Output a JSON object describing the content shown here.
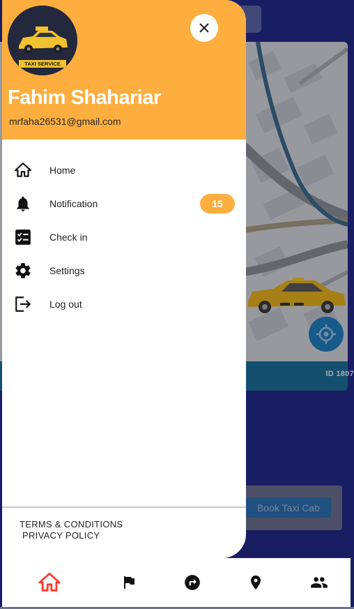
{
  "drawer": {
    "user_name": "Fahim Shahariar",
    "user_email": "mrfaha26531@gmail.com",
    "avatar_text": "TAXI SERVICE",
    "menu": [
      {
        "label": "Home",
        "icon": "home-icon"
      },
      {
        "label": "Notification",
        "icon": "bell-icon",
        "badge": "15"
      },
      {
        "label": "Check in",
        "icon": "checklist-icon"
      },
      {
        "label": "Settings",
        "icon": "gear-icon"
      },
      {
        "label": "Log out",
        "icon": "logout-icon"
      }
    ],
    "footer": {
      "terms": "TERMS & CONDITIONS",
      "privacy": "PRIVACY POLICY"
    }
  },
  "background": {
    "ride_id": "ID 1807",
    "book_button": "Book Taxi Cab"
  },
  "bottom_nav": [
    {
      "icon": "home-icon",
      "active": true
    },
    {
      "icon": "flag-icon",
      "active": false
    },
    {
      "icon": "route-icon",
      "active": false
    },
    {
      "icon": "location-pin-icon",
      "active": false
    },
    {
      "icon": "people-icon",
      "active": false
    }
  ],
  "colors": {
    "accent": "#fdae3f",
    "active_nav": "#ff3b2f",
    "background_app": "#232a8a",
    "info_bar": "#1c6f98"
  }
}
